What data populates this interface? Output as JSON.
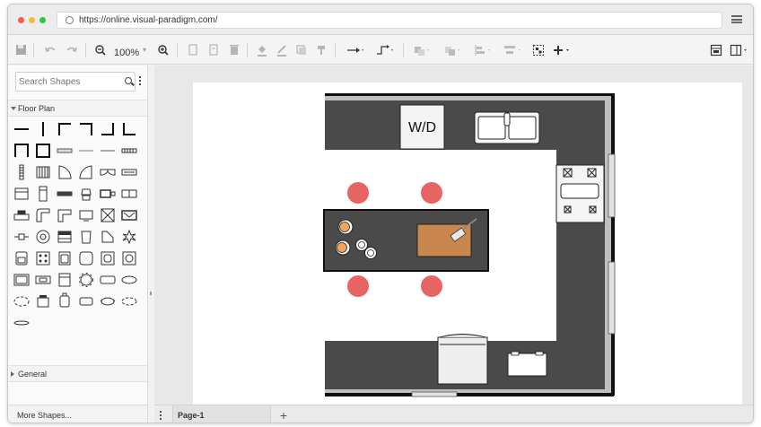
{
  "browser": {
    "url": "https://online.visual-paradigm.com/"
  },
  "toolbar": {
    "zoom": "100%"
  },
  "sidebar": {
    "search_placeholder": "Search Shapes",
    "section_floor_plan": "Floor Plan",
    "section_general": "General",
    "more_shapes": "More Shapes..."
  },
  "diagram": {
    "washer_dryer_label": "W/D"
  },
  "pages": {
    "tabs": [
      "Page-1"
    ]
  },
  "colors": {
    "counter": "#4a4a4a",
    "wall": "#111111",
    "stool": "#e86464",
    "cutting_board": "#c8874c",
    "plate_accent": "#f2a45a"
  }
}
